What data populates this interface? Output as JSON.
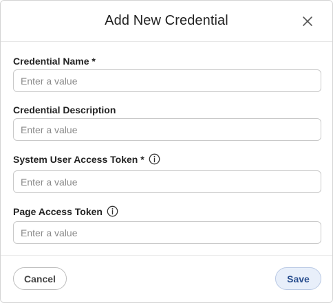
{
  "dialog": {
    "title": "Add New Credential"
  },
  "fields": [
    {
      "label": "Credential Name *",
      "placeholder": "Enter a value",
      "value": ""
    },
    {
      "label": "Credential Description",
      "placeholder": "Enter a value",
      "value": ""
    },
    {
      "label": "System User Access Token *",
      "placeholder": "Enter a value",
      "value": "",
      "has_info_icon": true
    },
    {
      "label": "Page Access Token",
      "placeholder": "Enter a value",
      "value": "",
      "has_info_icon": true
    }
  ],
  "footer": {
    "cancel_label": "Cancel",
    "save_label": "Save"
  },
  "icons": {
    "close": "close-icon",
    "info": "info-icon"
  },
  "colors": {
    "save_bg": "#e8effa",
    "save_text": "#2a4f8f"
  }
}
